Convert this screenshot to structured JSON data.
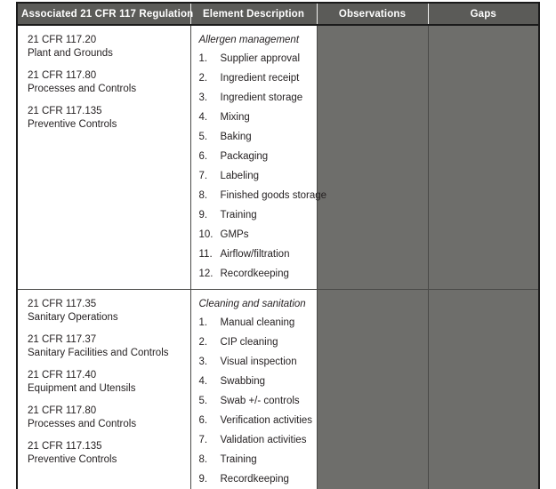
{
  "table": {
    "headers": [
      {
        "label": "Associated 21 CFR 117 Regulation",
        "name": "regulation"
      },
      {
        "label": "Element Description",
        "name": "element-description"
      },
      {
        "label": "Observations",
        "name": "observations"
      },
      {
        "label": "Gaps",
        "name": "gaps"
      }
    ],
    "colors": {
      "header_background": "#5b5b58",
      "header_text": "#ffffff",
      "shaded_cell": "#6e6e6b",
      "body_text": "#231f20",
      "border_outer": "#1a1a1a",
      "border_inner": "#4a4a48"
    },
    "rows": [
      {
        "regulations": [
          {
            "code": "21 CFR 117.20",
            "name": "Plant and Grounds"
          },
          {
            "code": "21 CFR 117.80",
            "name": "Processes and Controls"
          },
          {
            "code": "21 CFR 117.135",
            "name": "Preventive Controls"
          }
        ],
        "element": {
          "title": "Allergen management",
          "items": [
            {
              "num": "1.",
              "text": "Supplier approval"
            },
            {
              "num": "2.",
              "text": "Ingredient receipt"
            },
            {
              "num": "3.",
              "text": "Ingredient storage"
            },
            {
              "num": "4.",
              "text": "Mixing"
            },
            {
              "num": "5.",
              "text": "Baking"
            },
            {
              "num": "6.",
              "text": "Packaging"
            },
            {
              "num": "7.",
              "text": "Labeling"
            },
            {
              "num": "8.",
              "text": "Finished goods storage"
            },
            {
              "num": "9.",
              "text": "Training"
            },
            {
              "num": "10.",
              "text": "GMPs"
            },
            {
              "num": "11.",
              "text": "Airflow/filtration"
            },
            {
              "num": "12.",
              "text": "Recordkeeping"
            }
          ]
        },
        "observations": "",
        "gaps": ""
      },
      {
        "regulations": [
          {
            "code": "21 CFR 117.35",
            "name": "Sanitary Operations"
          },
          {
            "code": "21 CFR 117.37",
            "name": "Sanitary Facilities and Controls"
          },
          {
            "code": "21 CFR 117.40",
            "name": "Equipment and Utensils"
          },
          {
            "code": "21 CFR 117.80",
            "name": "Processes and Controls"
          },
          {
            "code": "21 CFR 117.135",
            "name": "Preventive Controls"
          }
        ],
        "element": {
          "title": "Cleaning and sanitation",
          "items": [
            {
              "num": "1.",
              "text": "Manual cleaning"
            },
            {
              "num": "2.",
              "text": "CIP cleaning"
            },
            {
              "num": "3.",
              "text": "Visual inspection"
            },
            {
              "num": "4.",
              "text": "Swabbing"
            },
            {
              "num": "5.",
              "text": "Swab +/- controls"
            },
            {
              "num": "6.",
              "text": "Verification activities"
            },
            {
              "num": "7.",
              "text": "Validation activities"
            },
            {
              "num": "8.",
              "text": "Training"
            },
            {
              "num": "9.",
              "text": "Recordkeeping"
            }
          ]
        },
        "observations": "",
        "gaps": ""
      }
    ]
  }
}
